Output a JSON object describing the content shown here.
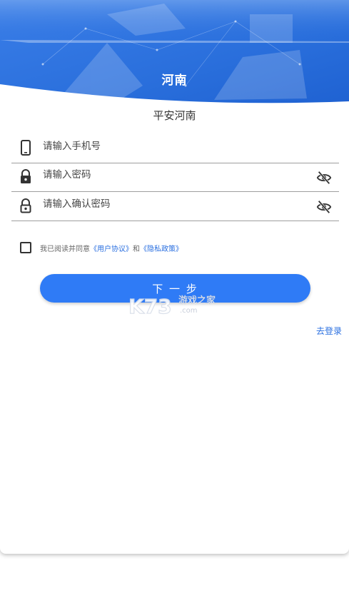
{
  "header": {
    "title": "河南"
  },
  "subtitle": "平安河南",
  "form": {
    "phone_placeholder": "请输入手机号",
    "password_placeholder": "请输入密码",
    "confirm_placeholder": "请输入确认密码"
  },
  "agreement": {
    "prefix": "我已阅读并同意",
    "user_agreement": "《用户协议》",
    "and": "和",
    "privacy_policy": "《隐私政策》",
    "checked": false
  },
  "next_button_label": "下 一 步",
  "login_link": "去登录",
  "watermark": {
    "brand": "K73",
    "name": "游戏之家",
    "domain": ".com"
  },
  "colors": {
    "primary": "#2f7bf6",
    "link": "#2a6fe0",
    "banner": "#2a6fdc"
  },
  "icons": [
    "phone-icon",
    "lock-icon",
    "lock-open-icon",
    "eye-off-icon"
  ]
}
